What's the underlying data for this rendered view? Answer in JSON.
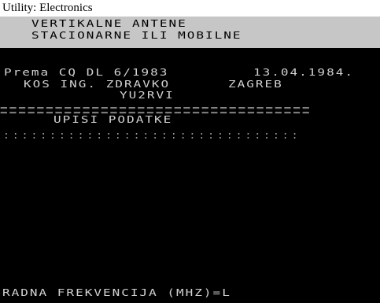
{
  "caption": "Utility: Electronics",
  "header": {
    "line1": "VERTIKALNE ANTENE",
    "line2": "STACIONARNE ILI MOBILNE"
  },
  "info": {
    "source": "Prema CQ DL 6/1983",
    "date": "13.04.1984.",
    "author": "KOS ING. ZDRAVKO",
    "city": "ZAGREB",
    "callsign": "YU2RVI"
  },
  "separator": "==================================",
  "section_title": "UPISI PODATKE",
  "dotted_row": "::::::::::::::::::::::::::::::::",
  "prompt": {
    "label": "RADNA FREKVENCIJA (MHZ)=",
    "cursor": "L"
  },
  "colors": {
    "screen_bg": "#000000",
    "header_band": "#c6c6c6",
    "text": "#d2d2d2"
  }
}
